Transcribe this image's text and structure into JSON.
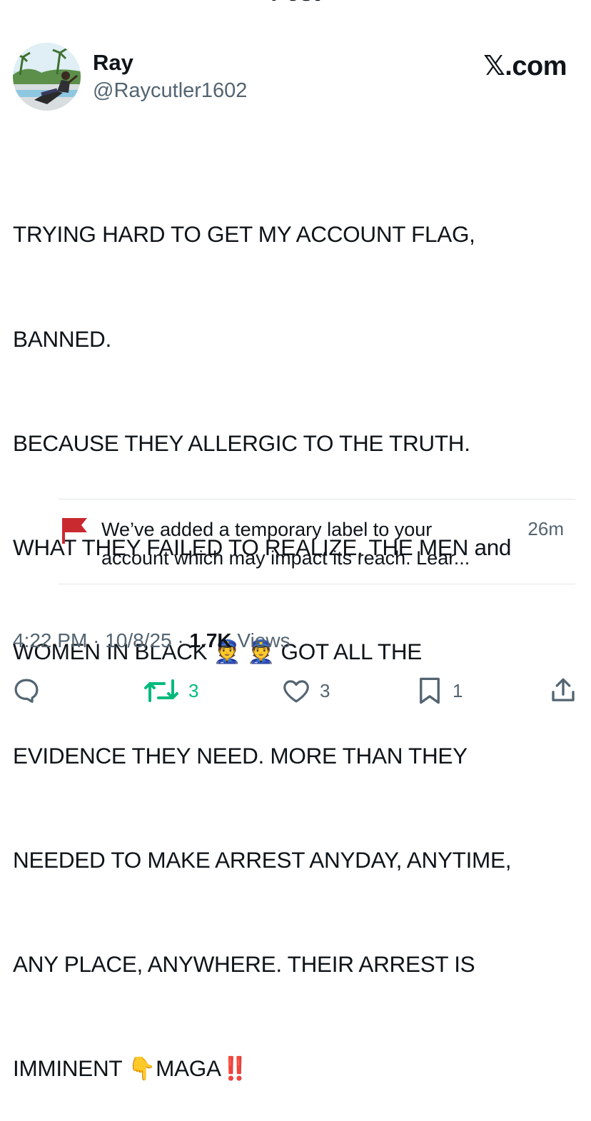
{
  "header": {
    "title": "Post"
  },
  "author": {
    "name": "Ray",
    "handle": "@Raycutler1602"
  },
  "brand": "𝕏.com",
  "post": {
    "lines": [
      "TRYING HARD TO GET MY ACCOUNT FLAG,",
      "BANNED.",
      "BECAUSE THEY ALLERGIC TO THE TRUTH.",
      "WHAT THEY FAILED TO REALIZE. THE MEN and",
      "WOMEN IN BLACK 👮 👮 GOT ALL THE",
      "EVIDENCE THEY NEED. MORE THAN THEY",
      "NEEDED TO MAKE ARREST ANYDAY, ANYTIME,",
      "ANY PLACE, ANYWHERE. THEIR ARREST IS",
      "IMMINENT 👇MAGA‼️"
    ]
  },
  "notice": {
    "icon": "flag-icon",
    "text_line1": "We’ve added a temporary label to your",
    "text_line2": "account which may impact its reach. Lear...",
    "time": "26m",
    "flag_color": "#c92a2f"
  },
  "meta": {
    "time": "4:22 PM",
    "date": "10/8/25",
    "views_count": "1.7K",
    "views_label": "Views"
  },
  "actions": {
    "replies": "",
    "reposts": "3",
    "likes": "3",
    "bookmarks": "1",
    "repost_color": "#00ba7c",
    "icon_color": "#536471"
  }
}
